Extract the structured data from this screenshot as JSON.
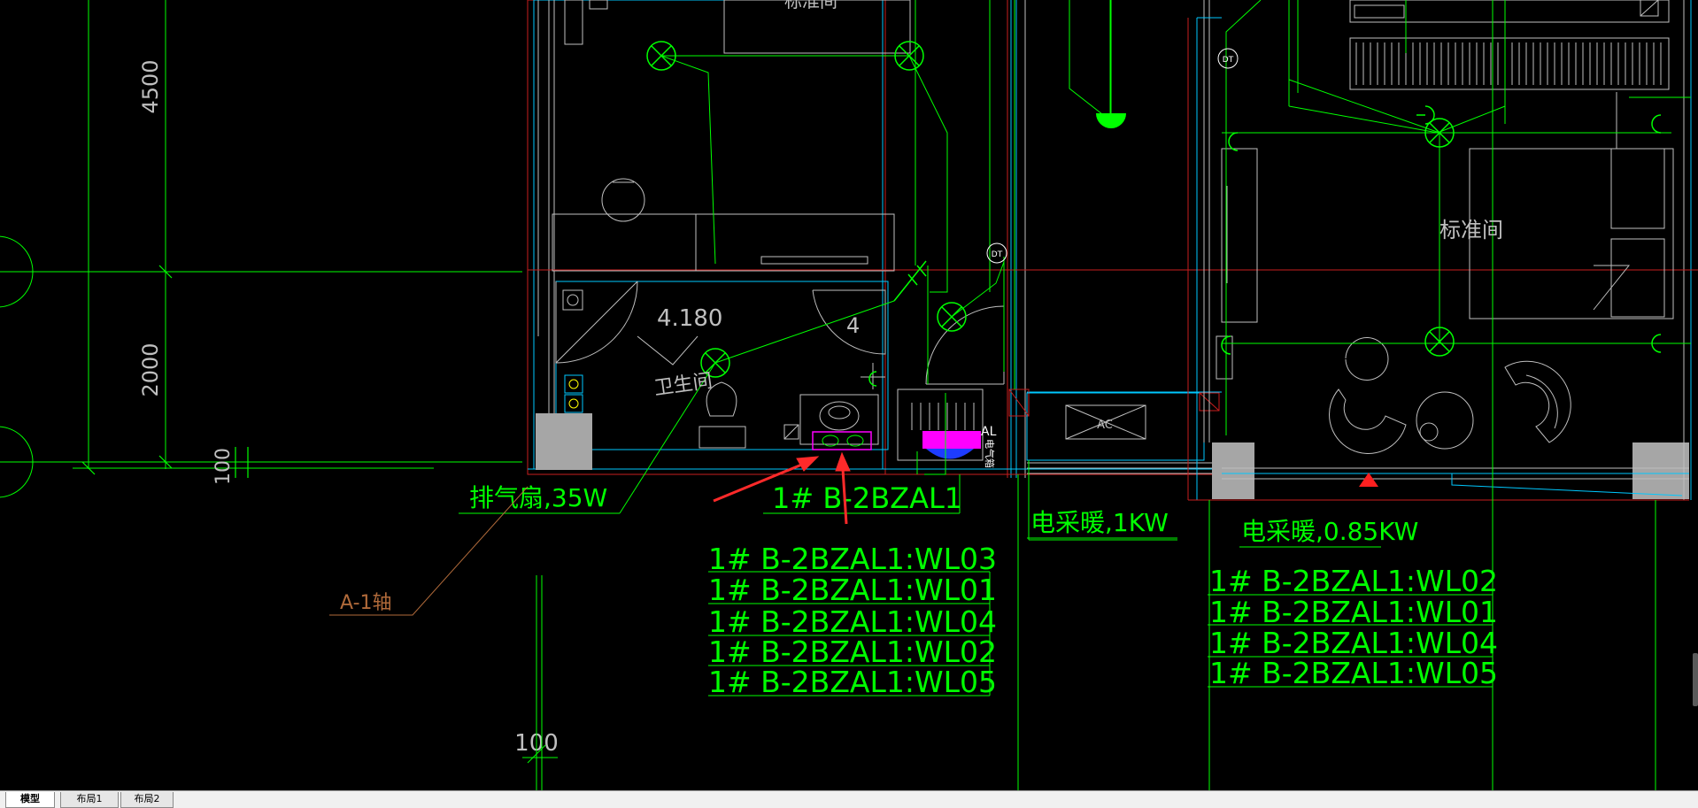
{
  "drawing": {
    "dim_left_upper": "4500",
    "dim_left_lower": "2000",
    "dim_100_vertical": "100",
    "dim_100_bottom": "100",
    "label_exhaust_fan": "排气扇,35W",
    "label_axis": "A-1轴",
    "label_bathroom": "卫生间",
    "label_elev": "4.180",
    "label_four": "4",
    "label_dt": "DT",
    "label_ac": "AC",
    "label_room_top": "标准间",
    "label_room_right": "标准间",
    "label_panel": "1# B-2BZAL1",
    "label_heater_1": "电采暖,1KW",
    "label_heater_2": "电采暖,0.85KW",
    "label_al": "AL",
    "label_panel_vertical": "电气箱",
    "circuits_left": [
      "1# B-2BZAL1:WL03",
      "1# B-2BZAL1:WL01",
      "1# B-2BZAL1:WL04",
      "1# B-2BZAL1:WL02",
      "1# B-2BZAL1:WL05"
    ],
    "circuits_right": [
      "1# B-2BZAL1:WL02",
      "1# B-2BZAL1:WL01",
      "1# B-2BZAL1:WL04",
      "1# B-2BZAL1:WL05"
    ]
  },
  "colors": {
    "background": "#000000",
    "line_green": "#00ff00",
    "line_cyan": "#00c8ff",
    "line_white": "#bfbfbf",
    "line_red": "#c81e1e",
    "line_brown": "#b06a3a",
    "fill_magenta": "#ff00ff",
    "fill_gray": "#a6a6a6",
    "arrow_red": "#ff2a2a"
  },
  "tabs": [
    "模型",
    "布局1",
    "布局2"
  ]
}
